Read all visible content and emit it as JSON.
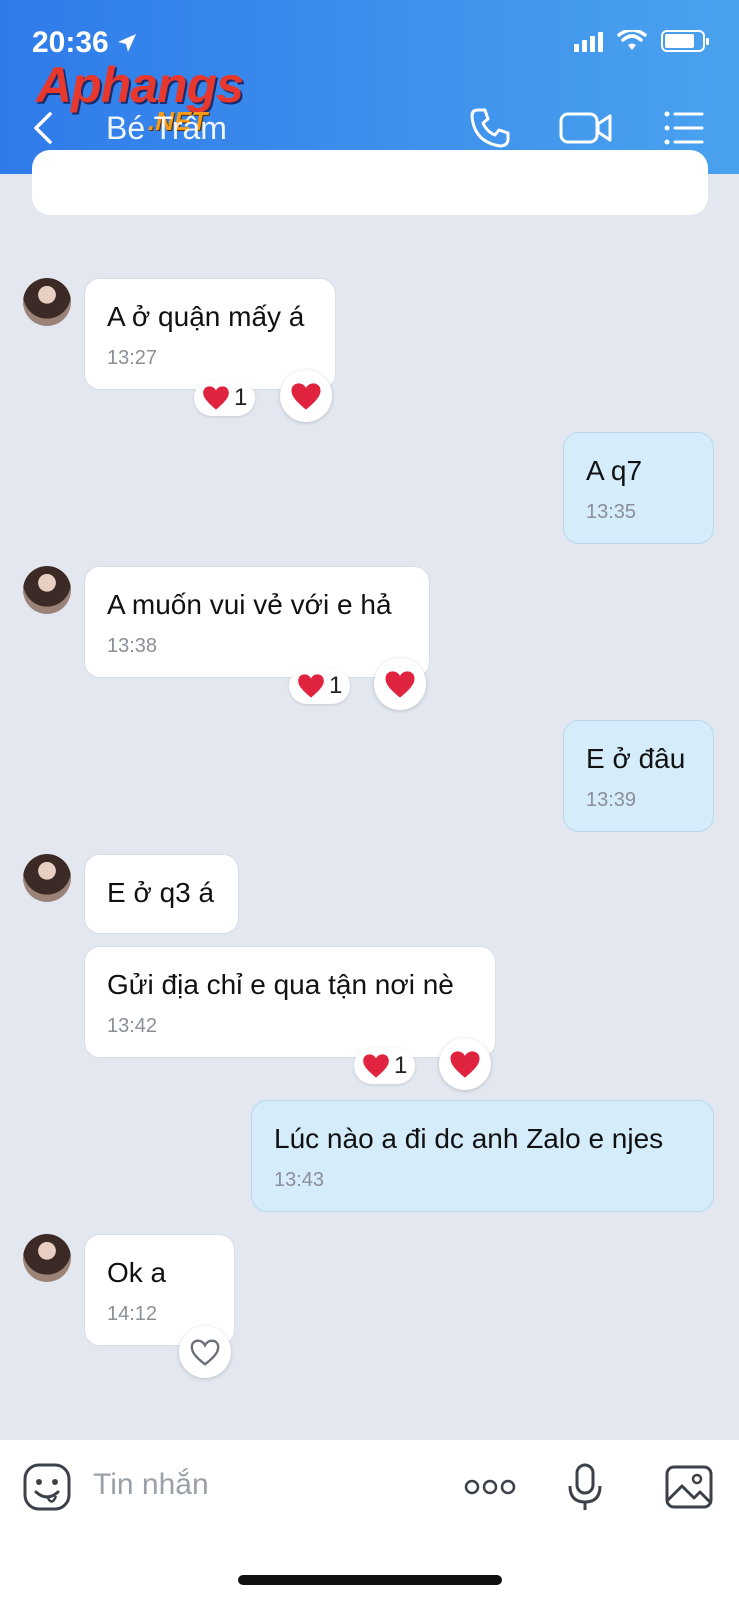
{
  "status_bar": {
    "time": "20:36"
  },
  "watermark": {
    "main": "Aphangs",
    "sub": ".NET"
  },
  "header": {
    "title": "Bé Trâm"
  },
  "colors": {
    "header_start": "#2f7bea",
    "header_end": "#4aa2ee",
    "my_bubble": "#d5ecfb",
    "heart": "#e0233e"
  },
  "messages": [
    {
      "sender": "them",
      "text": "A ở quận mấy á",
      "time": "13:27",
      "reaction_count": "1"
    },
    {
      "sender": "me",
      "text": "A q7",
      "time": "13:35"
    },
    {
      "sender": "them",
      "text": "A muốn vui vẻ với e hả",
      "time": "13:38",
      "reaction_count": "1"
    },
    {
      "sender": "me",
      "text": "E ở đâu",
      "time": "13:39"
    },
    {
      "sender": "them",
      "text": "E ở q3 á"
    },
    {
      "sender": "them",
      "text": "Gửi địa chỉ e qua tận nơi nè",
      "time": "13:42",
      "reaction_count": "1"
    },
    {
      "sender": "me",
      "text": "Lúc nào a đi dc anh Zalo e njes",
      "time": "13:43"
    },
    {
      "sender": "them",
      "text": "Ok a",
      "time": "14:12"
    }
  ],
  "input": {
    "placeholder": "Tin nhắn"
  }
}
